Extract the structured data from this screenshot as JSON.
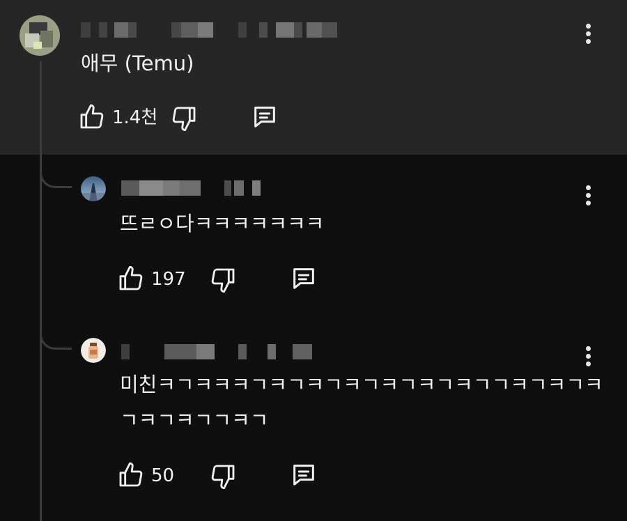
{
  "comment": {
    "text": "애무 (Temu)",
    "likes": "1.4천"
  },
  "replies": [
    {
      "text": "뜨ㄹㅇ다ㅋㅋㅋㅋㅋㅋㅋ",
      "likes": "197"
    },
    {
      "text_lines": [
        "미친ㅋㄱㅋㅋㅋㄱㅋㄱㅋㄱㅋㄱㅋㄱㅋㄱㅋㄱㄱㅋㄱㅋㄱㅋ",
        "ㄱㅋㄱㅋㄱㄱㅋㄱ"
      ],
      "likes": "50"
    }
  ],
  "icons": {
    "like": "thumbs-up-icon",
    "dislike": "thumbs-down-icon",
    "reply": "reply-icon",
    "more": "more-vertical-icon"
  },
  "colors": {
    "page_bg": "#0f0f0f",
    "parent_bg": "#262626",
    "text": "#f1f1f1",
    "thread_line": "#3c3c3c"
  }
}
